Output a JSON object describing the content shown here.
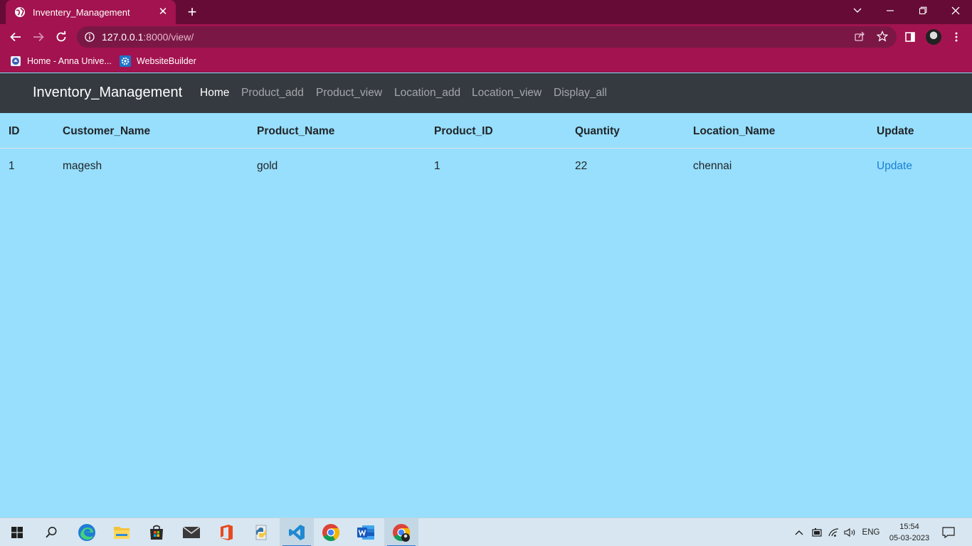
{
  "browser": {
    "tab_title": "Inventery_Management",
    "url_host": "127.0.0.1",
    "url_rest": ":8000/view/",
    "bookmarks": [
      {
        "label": "Home - Anna Unive...",
        "icon": "anna-university-icon"
      },
      {
        "label": "WebsiteBuilder",
        "icon": "gear-icon"
      }
    ]
  },
  "navbar": {
    "brand": "Inventory_Management",
    "links": [
      {
        "label": "Home",
        "active": true
      },
      {
        "label": "Product_add",
        "active": false
      },
      {
        "label": "Product_view",
        "active": false
      },
      {
        "label": "Location_add",
        "active": false
      },
      {
        "label": "Location_view",
        "active": false
      },
      {
        "label": "Display_all",
        "active": false
      }
    ]
  },
  "table": {
    "headers": [
      "ID",
      "Customer_Name",
      "Product_Name",
      "Product_ID",
      "Quantity",
      "Location_Name",
      "Update"
    ],
    "rows": [
      [
        "1",
        "magesh",
        "gold",
        "1",
        "22",
        "chennai",
        "Update"
      ]
    ]
  },
  "taskbar": {
    "apps": [
      "windows-start",
      "search",
      "edge",
      "file-explorer",
      "microsoft-store",
      "mail",
      "office",
      "python",
      "vscode",
      "chrome",
      "word",
      "chrome-profile"
    ],
    "language": "ENG",
    "time": "15:54",
    "date": "05-03-2023"
  },
  "colors": {
    "tab_strip": "#650b36",
    "toolbar": "#a2134f",
    "navbar": "#343a40",
    "page_bg": "#97dffd",
    "link": "#1b7fd6"
  }
}
